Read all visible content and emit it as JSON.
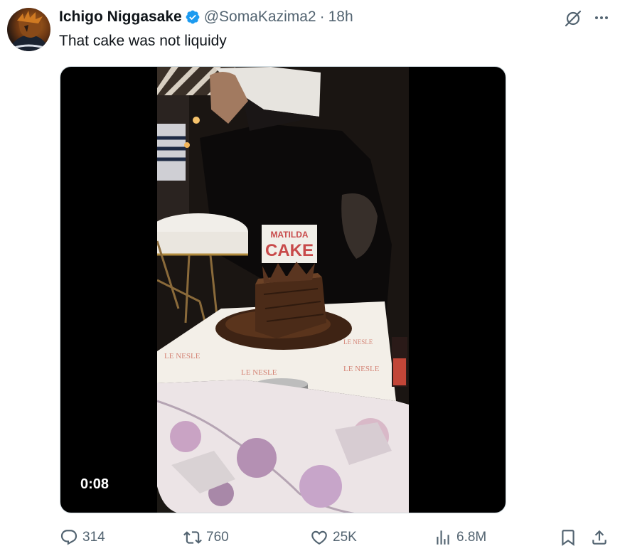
{
  "tweet": {
    "author_name": "Ichigo Niggasake",
    "handle": "@SomaKazima2",
    "separator": "·",
    "time": "18h",
    "text": "That cake was not liquidy",
    "verified": true
  },
  "media": {
    "duration": "0:08",
    "cake_sign_line1": "MATILDA",
    "cake_sign_line2": "CAKE",
    "placemat_text": "LE NESLE"
  },
  "actions": {
    "replies": "314",
    "retweets": "760",
    "likes": "25K",
    "views": "6.8M"
  },
  "colors": {
    "text_primary": "#0f1419",
    "text_secondary": "#536471",
    "verified_blue": "#1d9bf0",
    "border": "#cfd9de"
  },
  "icons": [
    "avatar",
    "verified-badge-icon",
    "grok-icon",
    "more-icon",
    "reply-icon",
    "retweet-icon",
    "like-icon",
    "views-icon",
    "bookmark-icon",
    "share-icon"
  ]
}
